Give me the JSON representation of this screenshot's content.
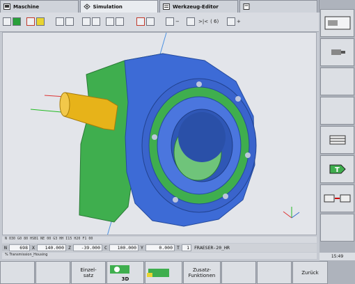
{
  "tabs": [
    {
      "label": "Maschine",
      "icon": "machine-icon"
    },
    {
      "label": "Simulation",
      "icon": "simulation-icon"
    },
    {
      "label": "Werkzeug-Editor",
      "icon": "tool-editor-icon"
    },
    {
      "label": "",
      "icon": "document-icon"
    }
  ],
  "toolbar": {
    "display_text": ">|<",
    "counter": "( 6)"
  },
  "status": {
    "line1": "N 030    G0 80 HSB1 NE 00 G3 HH I15 H20 F1 00",
    "fields": [
      {
        "label": "N",
        "value": "698"
      },
      {
        "label": "X",
        "value": "140.000"
      },
      {
        "label": "Z",
        "value": "-39.000"
      },
      {
        "label": "C",
        "value": "100.000"
      },
      {
        "label": "Y",
        "value": "0.000"
      },
      {
        "label": "T",
        "value": "1"
      }
    ],
    "tool_name": "FRAESER-20_HR",
    "program": "% Transmission_Housing"
  },
  "softkeys": {
    "einzelsatz": "Einzel-\nsatz",
    "threed": "3D",
    "zusatz": "Zusatz-\nFunktionen",
    "zurueck": "Zurück"
  },
  "clock": "15:49",
  "colors": {
    "part_blue": "#3d6bd6",
    "part_green": "#3fae4e",
    "tool_yellow": "#e7b319"
  }
}
